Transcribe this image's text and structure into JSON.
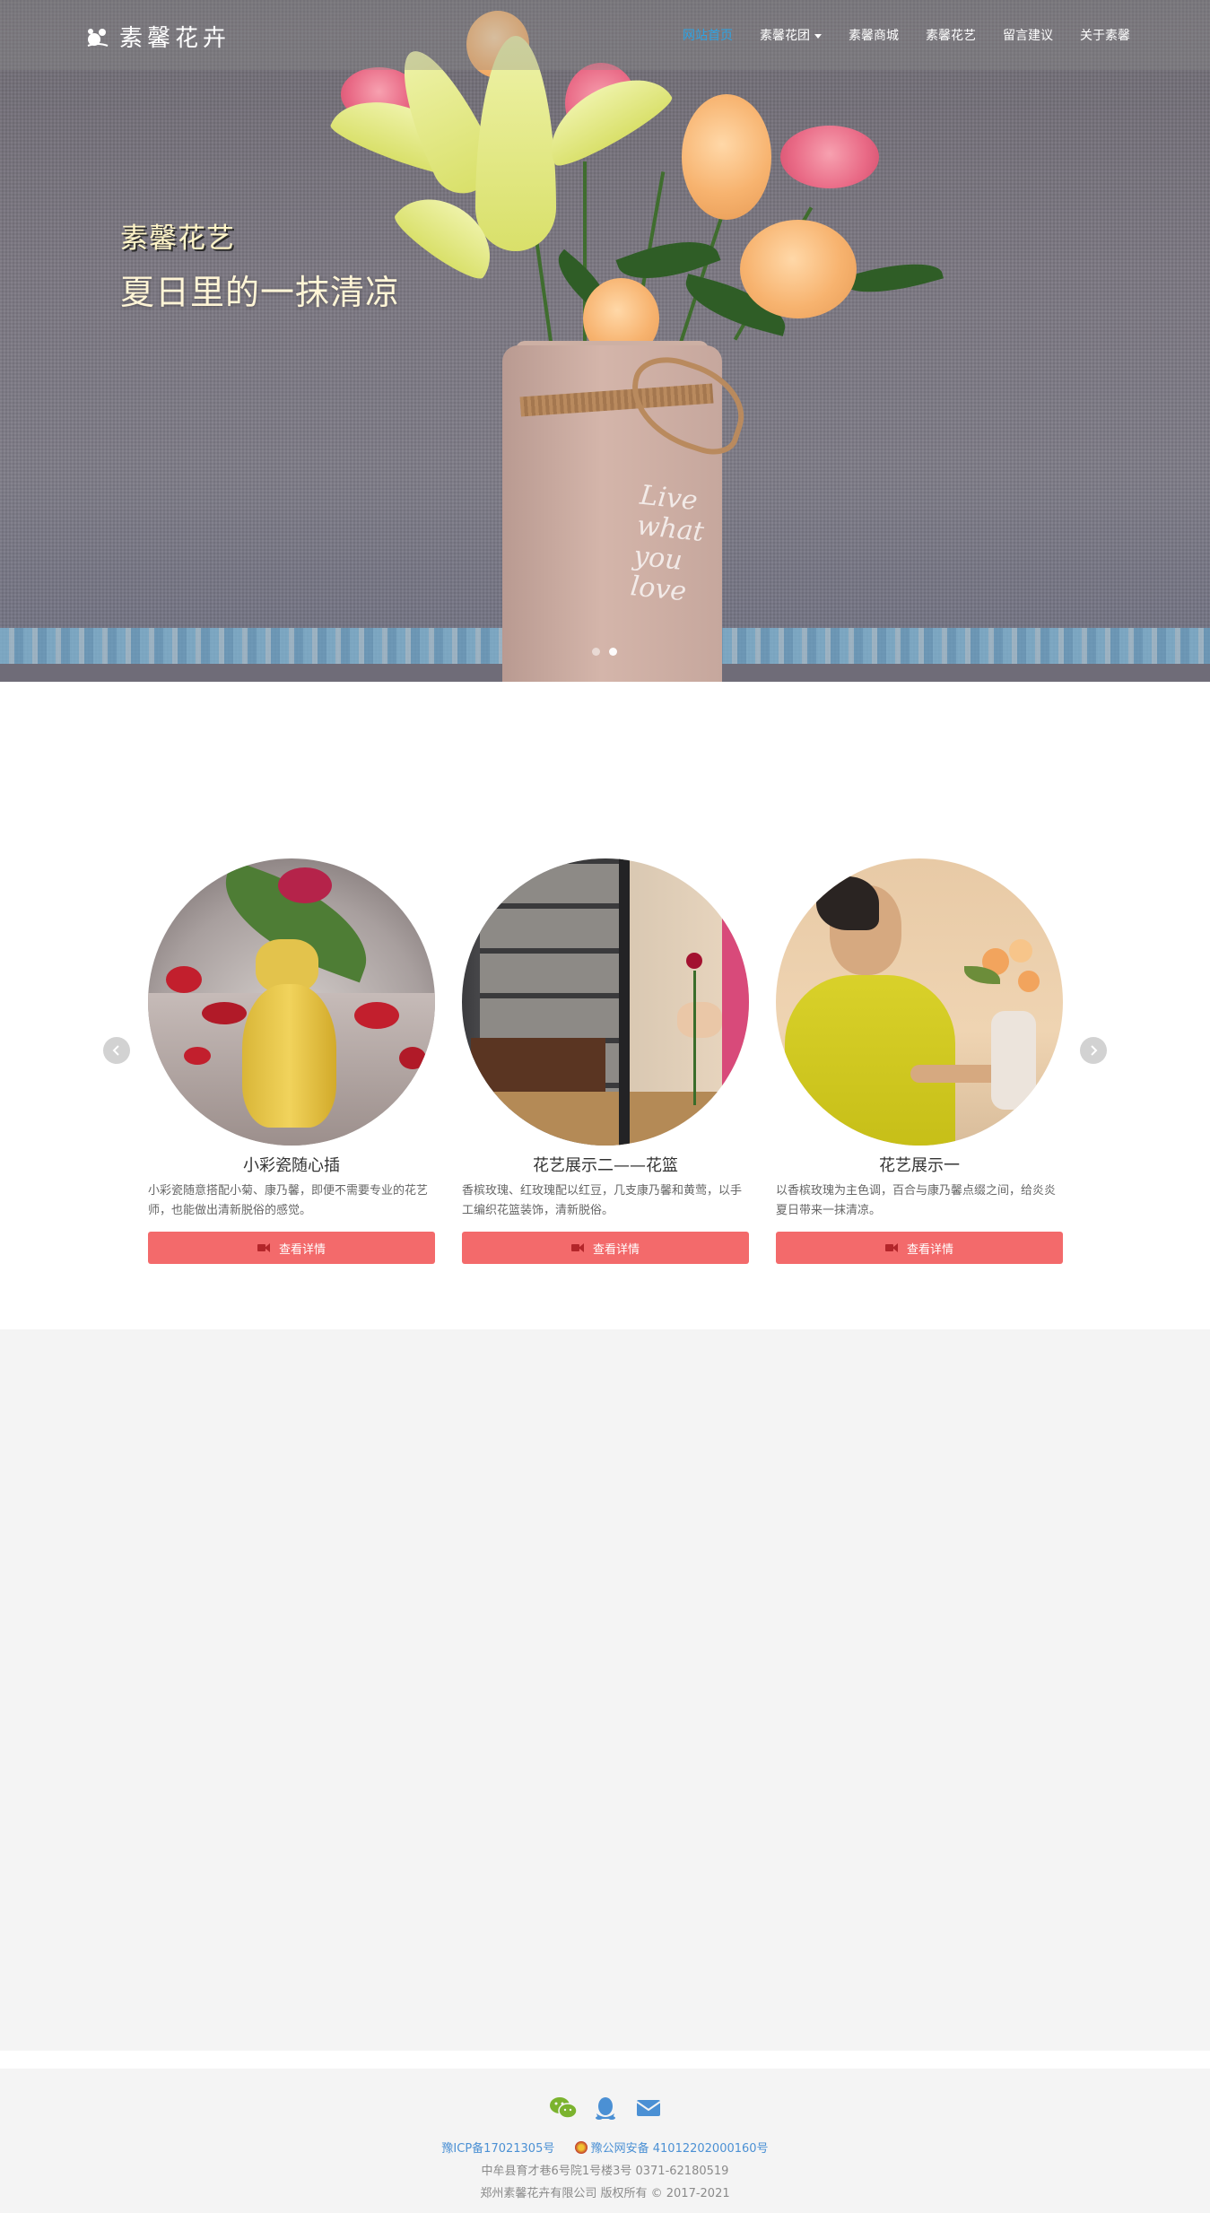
{
  "brand": {
    "logo_text": "素馨花卉"
  },
  "nav": {
    "items": [
      {
        "label": "网站首页",
        "active": true
      },
      {
        "label": "素馨花团",
        "has_dropdown": true
      },
      {
        "label": "素馨商城"
      },
      {
        "label": "素馨花艺"
      },
      {
        "label": "留言建议"
      },
      {
        "label": "关于素馨"
      }
    ]
  },
  "hero": {
    "brand_text": "素馨花艺",
    "title": "夏日里的一抹清凉",
    "vase_script": "Live what you love",
    "slides": 2,
    "active_slide": 1
  },
  "cards": {
    "items": [
      {
        "title": "小彩瓷随心插",
        "desc": "小彩瓷随意搭配小菊、康乃馨，即便不需要专业的花艺师，也能做出清新脱俗的感觉。",
        "button": "查看详情"
      },
      {
        "title": "花艺展示二——花篮",
        "desc": "香槟玫瑰、红玫瑰配以红豆，几支康乃馨和黄莺，以手工编织花篮装饰，清新脱俗。",
        "button": "查看详情"
      },
      {
        "title": "花艺展示一",
        "desc": "以香槟玫瑰为主色调，百合与康乃馨点缀之间，给炎炎夏日带来一抹清凉。",
        "button": "查看详情"
      }
    ]
  },
  "footer": {
    "icons": [
      "wechat-icon",
      "qq-icon",
      "email-icon"
    ],
    "icp": "豫ICP备17021305号",
    "police": "豫公网安备 41012202000160号",
    "address": "中牟县育才巷6号院1号楼3号 0371-62180519",
    "copyright": "郑州素馨花卉有限公司 版权所有 © 2017-2021"
  },
  "colors": {
    "accent_nav": "#2ea3e3",
    "button": "#f36a6b",
    "footer_link": "#4b90d4",
    "wechat": "#7bb32e",
    "qq": "#4b90d4"
  }
}
